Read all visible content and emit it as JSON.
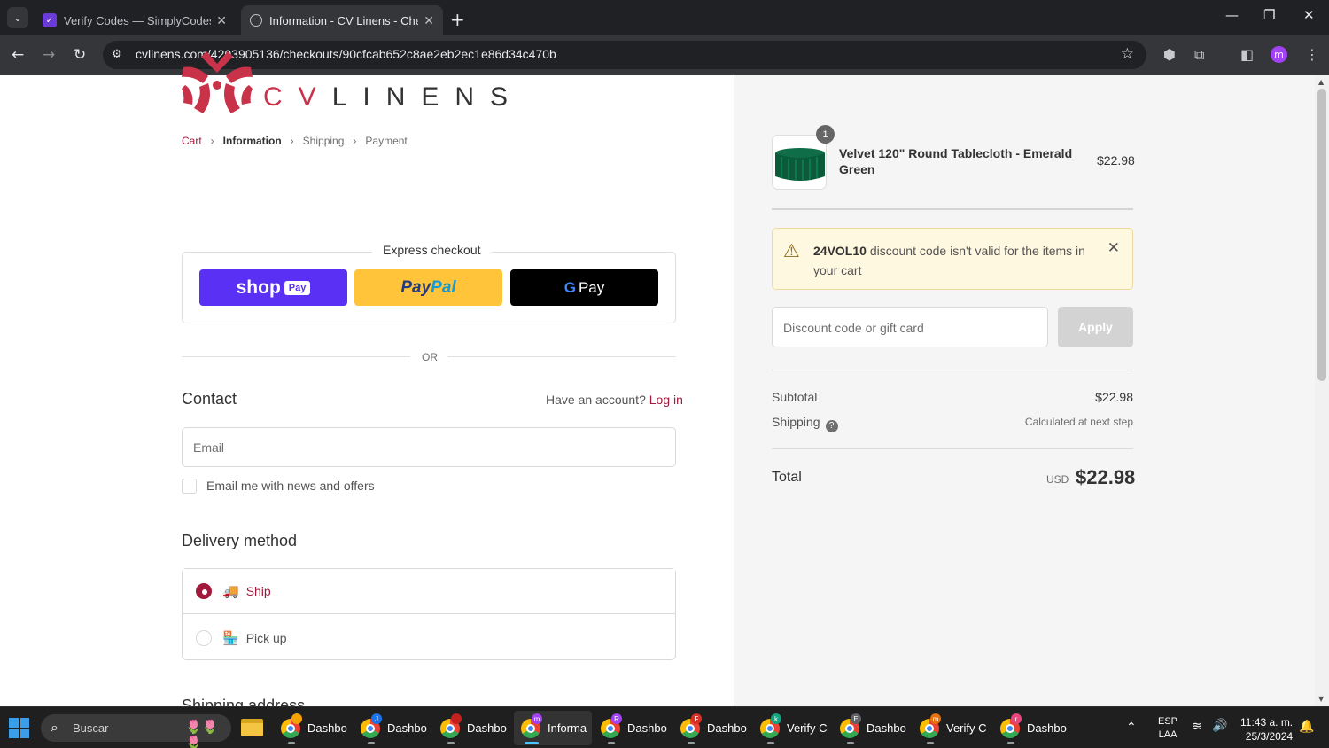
{
  "browser": {
    "tabs": [
      {
        "title": "Verify Codes — SimplyCodes",
        "active": false
      },
      {
        "title": "Information - CV Linens - Check",
        "active": true
      }
    ],
    "url": "cvlinens.com/4203905136/checkouts/90cfcab652c8ae2eb2ec1e86d34c470b",
    "profile_initial": "m"
  },
  "brand": {
    "logo_cv": "CV",
    "logo_linens": "LINENS",
    "accent_color": "#a11a3c"
  },
  "breadcrumb": {
    "cart": "Cart",
    "information": "Information",
    "shipping": "Shipping",
    "payment": "Payment"
  },
  "express": {
    "title": "Express checkout",
    "shop_label": "shop",
    "shop_pay": "Pay",
    "paypal_p": "Pay",
    "paypal_pal": "Pal",
    "gpay_g": "G",
    "gpay_label": "Pay",
    "or": "OR"
  },
  "contact": {
    "heading": "Contact",
    "have_account": "Have an account?",
    "login": "Log in",
    "email_placeholder": "Email",
    "newsletter_label": "Email me with news and offers",
    "newsletter_checked": false
  },
  "delivery": {
    "heading": "Delivery method",
    "options": [
      {
        "label": "Ship",
        "selected": true,
        "icon": "truck-icon"
      },
      {
        "label": "Pick up",
        "selected": false,
        "icon": "store-icon"
      }
    ],
    "next_heading": "Shipping address"
  },
  "summary": {
    "item": {
      "name": "Velvet 120\" Round Tablecloth - Emerald Green",
      "price": "$22.98",
      "qty": "1"
    },
    "warning": {
      "code": "24VOL10",
      "message": " discount code isn't valid for the items in your cart"
    },
    "discount_placeholder": "Discount code or gift card",
    "apply_label": "Apply",
    "subtotal_label": "Subtotal",
    "subtotal_value": "$22.98",
    "shipping_label": "Shipping",
    "shipping_value": "Calculated at next step",
    "total_label": "Total",
    "total_currency": "USD",
    "total_value": "$22.98"
  },
  "taskbar": {
    "search_placeholder": "Buscar",
    "apps": [
      {
        "label": "Dashbo",
        "badge": "",
        "badge_color": "#f4a300",
        "active": false
      },
      {
        "label": "Dashbo",
        "badge": "J",
        "badge_color": "#1a73e8",
        "active": false
      },
      {
        "label": "Dashbo",
        "badge": "",
        "badge_color": "#c5221f",
        "active": false
      },
      {
        "label": "Informa",
        "badge": "m",
        "badge_color": "#a142f4",
        "active": true
      },
      {
        "label": "Dashbo",
        "badge": "R",
        "badge_color": "#a142f4",
        "active": false
      },
      {
        "label": "Dashbo",
        "badge": "F",
        "badge_color": "#d93025",
        "active": false
      },
      {
        "label": "Verify C",
        "badge": "k",
        "badge_color": "#12a37f",
        "active": false
      },
      {
        "label": "Dashbo",
        "badge": "E",
        "badge_color": "#5f6368",
        "active": false
      },
      {
        "label": "Verify C",
        "badge": "m",
        "badge_color": "#e8710a",
        "active": false
      },
      {
        "label": "Dashbo",
        "badge": "r",
        "badge_color": "#e8457a",
        "active": false
      }
    ],
    "lang_top": "ESP",
    "lang_bottom": "LAA",
    "time": "11:43 a. m.",
    "date": "25/3/2024"
  }
}
